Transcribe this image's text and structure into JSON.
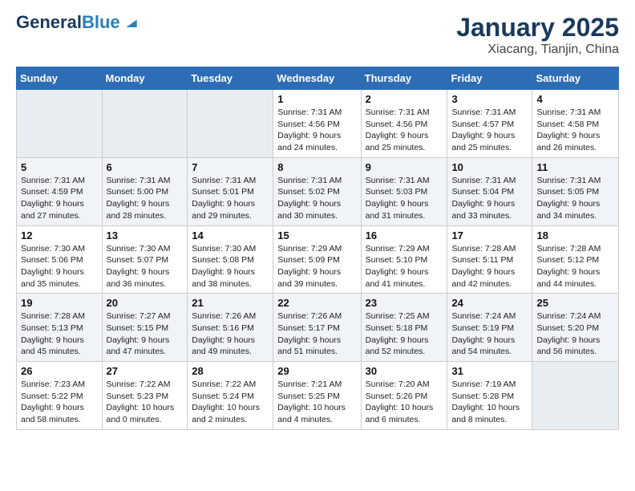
{
  "header": {
    "logo_line1": "General",
    "logo_line2": "Blue",
    "month": "January 2025",
    "location": "Xiacang, Tianjin, China"
  },
  "weekdays": [
    "Sunday",
    "Monday",
    "Tuesday",
    "Wednesday",
    "Thursday",
    "Friday",
    "Saturday"
  ],
  "weeks": [
    [
      {
        "day": "",
        "info": ""
      },
      {
        "day": "",
        "info": ""
      },
      {
        "day": "",
        "info": ""
      },
      {
        "day": "1",
        "info": "Sunrise: 7:31 AM\nSunset: 4:56 PM\nDaylight: 9 hours\nand 24 minutes."
      },
      {
        "day": "2",
        "info": "Sunrise: 7:31 AM\nSunset: 4:56 PM\nDaylight: 9 hours\nand 25 minutes."
      },
      {
        "day": "3",
        "info": "Sunrise: 7:31 AM\nSunset: 4:57 PM\nDaylight: 9 hours\nand 25 minutes."
      },
      {
        "day": "4",
        "info": "Sunrise: 7:31 AM\nSunset: 4:58 PM\nDaylight: 9 hours\nand 26 minutes."
      }
    ],
    [
      {
        "day": "5",
        "info": "Sunrise: 7:31 AM\nSunset: 4:59 PM\nDaylight: 9 hours\nand 27 minutes."
      },
      {
        "day": "6",
        "info": "Sunrise: 7:31 AM\nSunset: 5:00 PM\nDaylight: 9 hours\nand 28 minutes."
      },
      {
        "day": "7",
        "info": "Sunrise: 7:31 AM\nSunset: 5:01 PM\nDaylight: 9 hours\nand 29 minutes."
      },
      {
        "day": "8",
        "info": "Sunrise: 7:31 AM\nSunset: 5:02 PM\nDaylight: 9 hours\nand 30 minutes."
      },
      {
        "day": "9",
        "info": "Sunrise: 7:31 AM\nSunset: 5:03 PM\nDaylight: 9 hours\nand 31 minutes."
      },
      {
        "day": "10",
        "info": "Sunrise: 7:31 AM\nSunset: 5:04 PM\nDaylight: 9 hours\nand 33 minutes."
      },
      {
        "day": "11",
        "info": "Sunrise: 7:31 AM\nSunset: 5:05 PM\nDaylight: 9 hours\nand 34 minutes."
      }
    ],
    [
      {
        "day": "12",
        "info": "Sunrise: 7:30 AM\nSunset: 5:06 PM\nDaylight: 9 hours\nand 35 minutes."
      },
      {
        "day": "13",
        "info": "Sunrise: 7:30 AM\nSunset: 5:07 PM\nDaylight: 9 hours\nand 36 minutes."
      },
      {
        "day": "14",
        "info": "Sunrise: 7:30 AM\nSunset: 5:08 PM\nDaylight: 9 hours\nand 38 minutes."
      },
      {
        "day": "15",
        "info": "Sunrise: 7:29 AM\nSunset: 5:09 PM\nDaylight: 9 hours\nand 39 minutes."
      },
      {
        "day": "16",
        "info": "Sunrise: 7:29 AM\nSunset: 5:10 PM\nDaylight: 9 hours\nand 41 minutes."
      },
      {
        "day": "17",
        "info": "Sunrise: 7:28 AM\nSunset: 5:11 PM\nDaylight: 9 hours\nand 42 minutes."
      },
      {
        "day": "18",
        "info": "Sunrise: 7:28 AM\nSunset: 5:12 PM\nDaylight: 9 hours\nand 44 minutes."
      }
    ],
    [
      {
        "day": "19",
        "info": "Sunrise: 7:28 AM\nSunset: 5:13 PM\nDaylight: 9 hours\nand 45 minutes."
      },
      {
        "day": "20",
        "info": "Sunrise: 7:27 AM\nSunset: 5:15 PM\nDaylight: 9 hours\nand 47 minutes."
      },
      {
        "day": "21",
        "info": "Sunrise: 7:26 AM\nSunset: 5:16 PM\nDaylight: 9 hours\nand 49 minutes."
      },
      {
        "day": "22",
        "info": "Sunrise: 7:26 AM\nSunset: 5:17 PM\nDaylight: 9 hours\nand 51 minutes."
      },
      {
        "day": "23",
        "info": "Sunrise: 7:25 AM\nSunset: 5:18 PM\nDaylight: 9 hours\nand 52 minutes."
      },
      {
        "day": "24",
        "info": "Sunrise: 7:24 AM\nSunset: 5:19 PM\nDaylight: 9 hours\nand 54 minutes."
      },
      {
        "day": "25",
        "info": "Sunrise: 7:24 AM\nSunset: 5:20 PM\nDaylight: 9 hours\nand 56 minutes."
      }
    ],
    [
      {
        "day": "26",
        "info": "Sunrise: 7:23 AM\nSunset: 5:22 PM\nDaylight: 9 hours\nand 58 minutes."
      },
      {
        "day": "27",
        "info": "Sunrise: 7:22 AM\nSunset: 5:23 PM\nDaylight: 10 hours\nand 0 minutes."
      },
      {
        "day": "28",
        "info": "Sunrise: 7:22 AM\nSunset: 5:24 PM\nDaylight: 10 hours\nand 2 minutes."
      },
      {
        "day": "29",
        "info": "Sunrise: 7:21 AM\nSunset: 5:25 PM\nDaylight: 10 hours\nand 4 minutes."
      },
      {
        "day": "30",
        "info": "Sunrise: 7:20 AM\nSunset: 5:26 PM\nDaylight: 10 hours\nand 6 minutes."
      },
      {
        "day": "31",
        "info": "Sunrise: 7:19 AM\nSunset: 5:28 PM\nDaylight: 10 hours\nand 8 minutes."
      },
      {
        "day": "",
        "info": ""
      }
    ]
  ]
}
